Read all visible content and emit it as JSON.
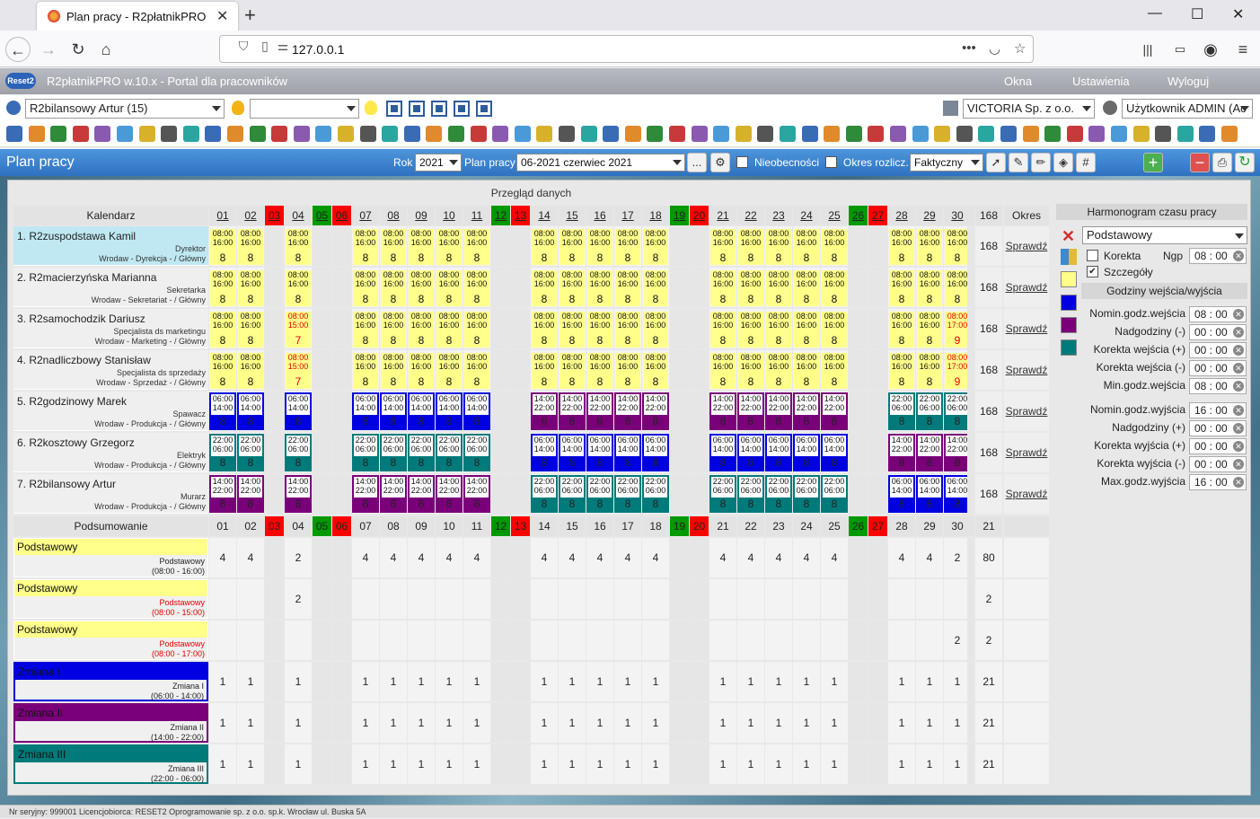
{
  "browser": {
    "tab_title": "Plan pracy - R2płatnikPRO",
    "url": "127.0.0.1"
  },
  "app": {
    "title": "R2płatnikPRO w.10.x - Portal dla pracowników",
    "menu": [
      "Okna",
      "Ustawienia",
      "Wyloguj"
    ],
    "logo": "Reset2"
  },
  "selectors": {
    "employee": "R2bilansowy Artur (15)",
    "company": "VICTORIA Sp. z o.o.",
    "user": "Użytkownik ADMIN (Ac"
  },
  "toolbar": {
    "page_title": "Plan pracy",
    "rok_label": "Rok",
    "rok": "2021",
    "plan_label": "Plan pracy",
    "plan": "06-2021 czerwiec 2021",
    "more": "...",
    "nieobecnosci": "Nieobecności",
    "okres_label": "Okres rozlicz.",
    "okres": "Faktyczny"
  },
  "grid": {
    "overview_title": "Przegląd danych",
    "calendar_label": "Kalendarz",
    "summary_label": "Podsumowanie",
    "okres_header": "Okres",
    "total_header": "168",
    "days": [
      {
        "d": "01",
        "t": "n"
      },
      {
        "d": "02",
        "t": "n"
      },
      {
        "d": "03",
        "t": "r"
      },
      {
        "d": "04",
        "t": "n"
      },
      {
        "d": "05",
        "t": "g"
      },
      {
        "d": "06",
        "t": "r"
      },
      {
        "d": "07",
        "t": "n"
      },
      {
        "d": "08",
        "t": "n"
      },
      {
        "d": "09",
        "t": "n"
      },
      {
        "d": "10",
        "t": "n"
      },
      {
        "d": "11",
        "t": "n"
      },
      {
        "d": "12",
        "t": "g"
      },
      {
        "d": "13",
        "t": "r"
      },
      {
        "d": "14",
        "t": "n"
      },
      {
        "d": "15",
        "t": "n"
      },
      {
        "d": "16",
        "t": "n"
      },
      {
        "d": "17",
        "t": "n"
      },
      {
        "d": "18",
        "t": "n"
      },
      {
        "d": "19",
        "t": "g"
      },
      {
        "d": "20",
        "t": "r"
      },
      {
        "d": "21",
        "t": "n"
      },
      {
        "d": "22",
        "t": "n"
      },
      {
        "d": "23",
        "t": "n"
      },
      {
        "d": "24",
        "t": "n"
      },
      {
        "d": "25",
        "t": "n"
      },
      {
        "d": "26",
        "t": "g"
      },
      {
        "d": "27",
        "t": "r"
      },
      {
        "d": "28",
        "t": "n"
      },
      {
        "d": "29",
        "t": "n"
      },
      {
        "d": "30",
        "t": "n"
      }
    ],
    "employees": [
      {
        "name": "1. R2zuspodstawa Kamil",
        "position": "Dyrektor",
        "location": "Wrodaw - Dyrekcja - / Główny",
        "bg": "#bfe8f2",
        "total": "168",
        "link": "Sprawdź",
        "cells": [
          "y|08:00|16:00|8",
          "y|08:00|16:00|8",
          "",
          "y|08:00|16:00|8",
          "",
          "",
          "y|08:00|16:00|8",
          "y|08:00|16:00|8",
          "y|08:00|16:00|8",
          "y|08:00|16:00|8",
          "y|08:00|16:00|8",
          "",
          "",
          "y|08:00|16:00|8",
          "y|08:00|16:00|8",
          "y|08:00|16:00|8",
          "y|08:00|16:00|8",
          "y|08:00|16:00|8",
          "",
          "",
          "y|08:00|16:00|8",
          "y|08:00|16:00|8",
          "y|08:00|16:00|8",
          "y|08:00|16:00|8",
          "y|08:00|16:00|8",
          "",
          "",
          "y|08:00|16:00|8",
          "y|08:00|16:00|8",
          "y|08:00|16:00|8"
        ]
      },
      {
        "name": "2. R2macierzyńska Marianna",
        "position": "Sekretarka",
        "location": "Wrodaw - Sekretariat - / Główny",
        "bg": "#efefef",
        "total": "168",
        "link": "Sprawdź",
        "cells": [
          "y|08:00|16:00|8",
          "y|08:00|16:00|8",
          "",
          "y|08:00|16:00|8",
          "",
          "",
          "y|08:00|16:00|8",
          "y|08:00|16:00|8",
          "y|08:00|16:00|8",
          "y|08:00|16:00|8",
          "y|08:00|16:00|8",
          "",
          "",
          "y|08:00|16:00|8",
          "y|08:00|16:00|8",
          "y|08:00|16:00|8",
          "y|08:00|16:00|8",
          "y|08:00|16:00|8",
          "",
          "",
          "y|08:00|16:00|8",
          "y|08:00|16:00|8",
          "y|08:00|16:00|8",
          "y|08:00|16:00|8",
          "y|08:00|16:00|8",
          "",
          "",
          "y|08:00|16:00|8",
          "y|08:00|16:00|8",
          "y|08:00|16:00|8"
        ]
      },
      {
        "name": "3. R2samochodzik Dariusz",
        "position": "Specjalista ds marketingu",
        "location": "Wrodaw - Marketing - / Główny",
        "bg": "#efefef",
        "total": "168",
        "link": "Sprawdź",
        "cells": [
          "y|08:00|16:00|8",
          "y|08:00|16:00|8",
          "",
          "yr|08:00|15:00|7",
          "",
          "",
          "y|08:00|16:00|8",
          "y|08:00|16:00|8",
          "y|08:00|16:00|8",
          "y|08:00|16:00|8",
          "y|08:00|16:00|8",
          "",
          "",
          "y|08:00|16:00|8",
          "y|08:00|16:00|8",
          "y|08:00|16:00|8",
          "y|08:00|16:00|8",
          "y|08:00|16:00|8",
          "",
          "",
          "y|08:00|16:00|8",
          "y|08:00|16:00|8",
          "y|08:00|16:00|8",
          "y|08:00|16:00|8",
          "y|08:00|16:00|8",
          "",
          "",
          "y|08:00|16:00|8",
          "y|08:00|16:00|8",
          "yr|08:00|17:00|9"
        ]
      },
      {
        "name": "4. R2nadliczbowy Stanisław",
        "position": "Specjalista ds sprzedaży",
        "location": "Wrodaw - Sprzedaż - / Główny",
        "bg": "#efefef",
        "total": "168",
        "link": "Sprawdź",
        "cells": [
          "y|08:00|16:00|8",
          "y|08:00|16:00|8",
          "",
          "yr|08:00|15:00|7",
          "",
          "",
          "y|08:00|16:00|8",
          "y|08:00|16:00|8",
          "y|08:00|16:00|8",
          "y|08:00|16:00|8",
          "y|08:00|16:00|8",
          "",
          "",
          "y|08:00|16:00|8",
          "y|08:00|16:00|8",
          "y|08:00|16:00|8",
          "y|08:00|16:00|8",
          "y|08:00|16:00|8",
          "",
          "",
          "y|08:00|16:00|8",
          "y|08:00|16:00|8",
          "y|08:00|16:00|8",
          "y|08:00|16:00|8",
          "y|08:00|16:00|8",
          "",
          "",
          "y|08:00|16:00|8",
          "y|08:00|16:00|8",
          "yr|08:00|17:00|9"
        ]
      },
      {
        "name": "5. R2godzinowy Marek",
        "position": "Spawacz",
        "location": "Wrodaw - Produkcja - / Główny",
        "bg": "#efefef",
        "total": "168",
        "link": "Sprawdź",
        "cells": [
          "bl|06:00|14:00|8",
          "bl|06:00|14:00|8",
          "",
          "bl|06:00|14:00|8",
          "",
          "",
          "bl|06:00|14:00|8",
          "bl|06:00|14:00|8",
          "bl|06:00|14:00|8",
          "bl|06:00|14:00|8",
          "bl|06:00|14:00|8",
          "",
          "",
          "pu|14:00|22:00|8",
          "pu|14:00|22:00|8",
          "pu|14:00|22:00|8",
          "pu|14:00|22:00|8",
          "pu|14:00|22:00|8",
          "",
          "",
          "pu|14:00|22:00|8",
          "pu|14:00|22:00|8",
          "pu|14:00|22:00|8",
          "pu|14:00|22:00|8",
          "pu|14:00|22:00|8",
          "",
          "",
          "te|22:00|06:00|8",
          "te|22:00|06:00|8",
          "te|22:00|06:00|8"
        ]
      },
      {
        "name": "6. R2kosztowy Grzegorz",
        "position": "Elektryk",
        "location": "Wrodaw - Produkcja - / Główny",
        "bg": "#efefef",
        "total": "168",
        "link": "Sprawdź",
        "cells": [
          "te|22:00|06:00|8",
          "te|22:00|06:00|8",
          "",
          "te|22:00|06:00|8",
          "",
          "",
          "te|22:00|06:00|8",
          "te|22:00|06:00|8",
          "te|22:00|06:00|8",
          "te|22:00|06:00|8",
          "te|22:00|06:00|8",
          "",
          "",
          "bl|06:00|14:00|8",
          "bl|06:00|14:00|8",
          "bl|06:00|14:00|8",
          "bl|06:00|14:00|8",
          "bl|06:00|14:00|8",
          "",
          "",
          "bl|06:00|14:00|8",
          "bl|06:00|14:00|8",
          "bl|06:00|14:00|8",
          "bl|06:00|14:00|8",
          "bl|06:00|14:00|8",
          "",
          "",
          "pu|14:00|22:00|8",
          "pu|14:00|22:00|8",
          "pu|14:00|22:00|8"
        ]
      },
      {
        "name": "7. R2bilansowy Artur",
        "position": "Murarz",
        "location": "Wrodaw - Produkcja - / Główny",
        "bg": "#efefef",
        "total": "168",
        "link": "Sprawdź",
        "cells": [
          "pu|14:00|22:00|8",
          "pu|14:00|22:00|8",
          "",
          "pu|14:00|22:00|8",
          "",
          "",
          "pu|14:00|22:00|8",
          "pu|14:00|22:00|8",
          "pu|14:00|22:00|8",
          "pu|14:00|22:00|8",
          "pu|14:00|22:00|8",
          "",
          "",
          "te|22:00|06:00|8",
          "te|22:00|06:00|8",
          "te|22:00|06:00|8",
          "te|22:00|06:00|8",
          "te|22:00|06:00|8",
          "",
          "",
          "te|22:00|06:00|8",
          "te|22:00|06:00|8",
          "te|22:00|06:00|8",
          "te|22:00|06:00|8",
          "te|22:00|06:00|8",
          "",
          "",
          "bl|06:00|14:00|8",
          "bl|06:00|14:00|8",
          "bl|06:00|14:00|8"
        ]
      }
    ],
    "summary_total_header": "21",
    "summary": [
      {
        "title": "Podstawowy",
        "sub": "Podstawowy",
        "hours": "(08:00 - 16:00)",
        "bg": "#ffff8a",
        "subcolor": "#222",
        "total": "80",
        "vals": [
          "4",
          "4",
          "",
          "2",
          "",
          "",
          "4",
          "4",
          "4",
          "4",
          "4",
          "",
          "",
          "4",
          "4",
          "4",
          "4",
          "4",
          "",
          "",
          "4",
          "4",
          "4",
          "4",
          "4",
          "",
          "",
          "4",
          "4",
          "2"
        ]
      },
      {
        "title": "Podstawowy",
        "sub": "Podstawowy",
        "hours": "(08:00 - 15:00)",
        "bg": "#ffff8a",
        "subcolor": "#e00000",
        "total": "2",
        "vals": [
          "",
          "",
          "",
          "2",
          "",
          "",
          "",
          "",
          "",
          "",
          "",
          "",
          "",
          "",
          "",
          "",
          "",
          "",
          "",
          "",
          "",
          "",
          "",
          "",
          "",
          "",
          "",
          "",
          "",
          ""
        ]
      },
      {
        "title": "Podstawowy",
        "sub": "Podstawowy",
        "hours": "(08:00 - 17:00)",
        "bg": "#ffff8a",
        "subcolor": "#e00000",
        "total": "2",
        "vals": [
          "",
          "",
          "",
          "",
          "",
          "",
          "",
          "",
          "",
          "",
          "",
          "",
          "",
          "",
          "",
          "",
          "",
          "",
          "",
          "",
          "",
          "",
          "",
          "",
          "",
          "",
          "",
          "",
          "",
          "2"
        ]
      },
      {
        "title": "Zmiana I",
        "sub": "Zmiana I",
        "hours": "(06:00 - 14:00)",
        "bg": "#0000e0",
        "subcolor": "#222",
        "total": "21",
        "vals": [
          "1",
          "1",
          "",
          "1",
          "",
          "",
          "1",
          "1",
          "1",
          "1",
          "1",
          "",
          "",
          "1",
          "1",
          "1",
          "1",
          "1",
          "",
          "",
          "1",
          "1",
          "1",
          "1",
          "1",
          "",
          "",
          "1",
          "1",
          "1"
        ]
      },
      {
        "title": "Zmiana II",
        "sub": "Zmiana II",
        "hours": "(14:00 - 22:00)",
        "bg": "#7a007a",
        "subcolor": "#222",
        "total": "21",
        "vals": [
          "1",
          "1",
          "",
          "1",
          "",
          "",
          "1",
          "1",
          "1",
          "1",
          "1",
          "",
          "",
          "1",
          "1",
          "1",
          "1",
          "1",
          "",
          "",
          "1",
          "1",
          "1",
          "1",
          "1",
          "",
          "",
          "1",
          "1",
          "1"
        ]
      },
      {
        "title": "Zmiana III",
        "sub": "Zmiana III",
        "hours": "(22:00 - 06:00)",
        "bg": "#007a7a",
        "subcolor": "#222",
        "total": "21",
        "vals": [
          "1",
          "1",
          "",
          "1",
          "",
          "",
          "1",
          "1",
          "1",
          "1",
          "1",
          "",
          "",
          "1",
          "1",
          "1",
          "1",
          "1",
          "",
          "",
          "1",
          "1",
          "1",
          "1",
          "1",
          "",
          "",
          "1",
          "1",
          "1"
        ]
      }
    ]
  },
  "sidebar": {
    "title": "Harmonogram czasu pracy",
    "schedule": "Podstawowy",
    "korekta": "Korekta",
    "ngp_label": "Ngp",
    "ngp": "08 : 00",
    "szczegoly": "Szczegóły",
    "section": "Godziny wejścia/wyjścia",
    "rows_in": [
      {
        "label": "Nomin.godz.wejścia",
        "val": "08 : 00"
      },
      {
        "label": "Nadgodziny (-)",
        "val": "00 : 00"
      },
      {
        "label": "Korekta wejścia (+)",
        "val": "00 : 00"
      },
      {
        "label": "Korekta wejścia (-)",
        "val": "00 : 00"
      },
      {
        "label": "Min.godz.wejścia",
        "val": "08 : 00"
      }
    ],
    "rows_out": [
      {
        "label": "Nomin.godz.wyjścia",
        "val": "16 : 00"
      },
      {
        "label": "Nadgodziny (+)",
        "val": "00 : 00"
      },
      {
        "label": "Korekta wyjścia (+)",
        "val": "00 : 00"
      },
      {
        "label": "Korekta wyjścia (-)",
        "val": "00 : 00"
      },
      {
        "label": "Max.godz.wyjścia",
        "val": "16 : 00"
      }
    ],
    "swatch_colors": [
      "#ffff8a",
      "#0000e0",
      "#7a007a",
      "#007a7a"
    ]
  },
  "status": "Nr seryjny: 999001 Licencjobiorca: RESET2 Oprogramowanie sp. z o.o. sp.k. Wrocław ul. Buska 5A"
}
